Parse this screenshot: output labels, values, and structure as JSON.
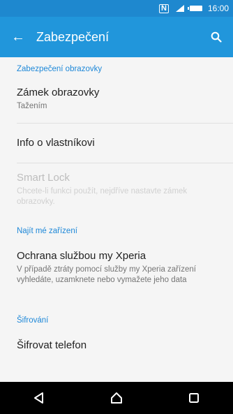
{
  "status_bar": {
    "time": "16:00"
  },
  "app_bar": {
    "title": "Zabezpečení"
  },
  "sections": {
    "screen": "Zabezpečení obrazovky",
    "find": "Najít mé zařízení",
    "encryption": "Šifrování"
  },
  "items": {
    "screen_lock": {
      "title": "Zámek obrazovky",
      "subtitle": "Tažením"
    },
    "owner_info": {
      "title": "Info o vlastníkovi"
    },
    "smart_lock": {
      "title": "Smart Lock",
      "subtitle": "Chcete-li funkci použít, nejdříve nastavte zámek obrazovky."
    },
    "my_xperia": {
      "title": "Ochrana službou my Xperia",
      "subtitle": "V případě ztráty pomocí služby my Xperia zařízení vyhledáte, uzamknete nebo vymažete jeho data"
    },
    "encrypt_phone": {
      "title": "Šifrovat telefon"
    }
  },
  "colors": {
    "status_bar": "#1e88cf",
    "app_bar": "#2196db",
    "section_header": "#1e88d8"
  },
  "icons": [
    "nfc-icon",
    "signal-icon",
    "battery-icon",
    "back-arrow-icon",
    "search-icon",
    "nav-back-icon",
    "nav-home-icon",
    "nav-recents-icon"
  ]
}
